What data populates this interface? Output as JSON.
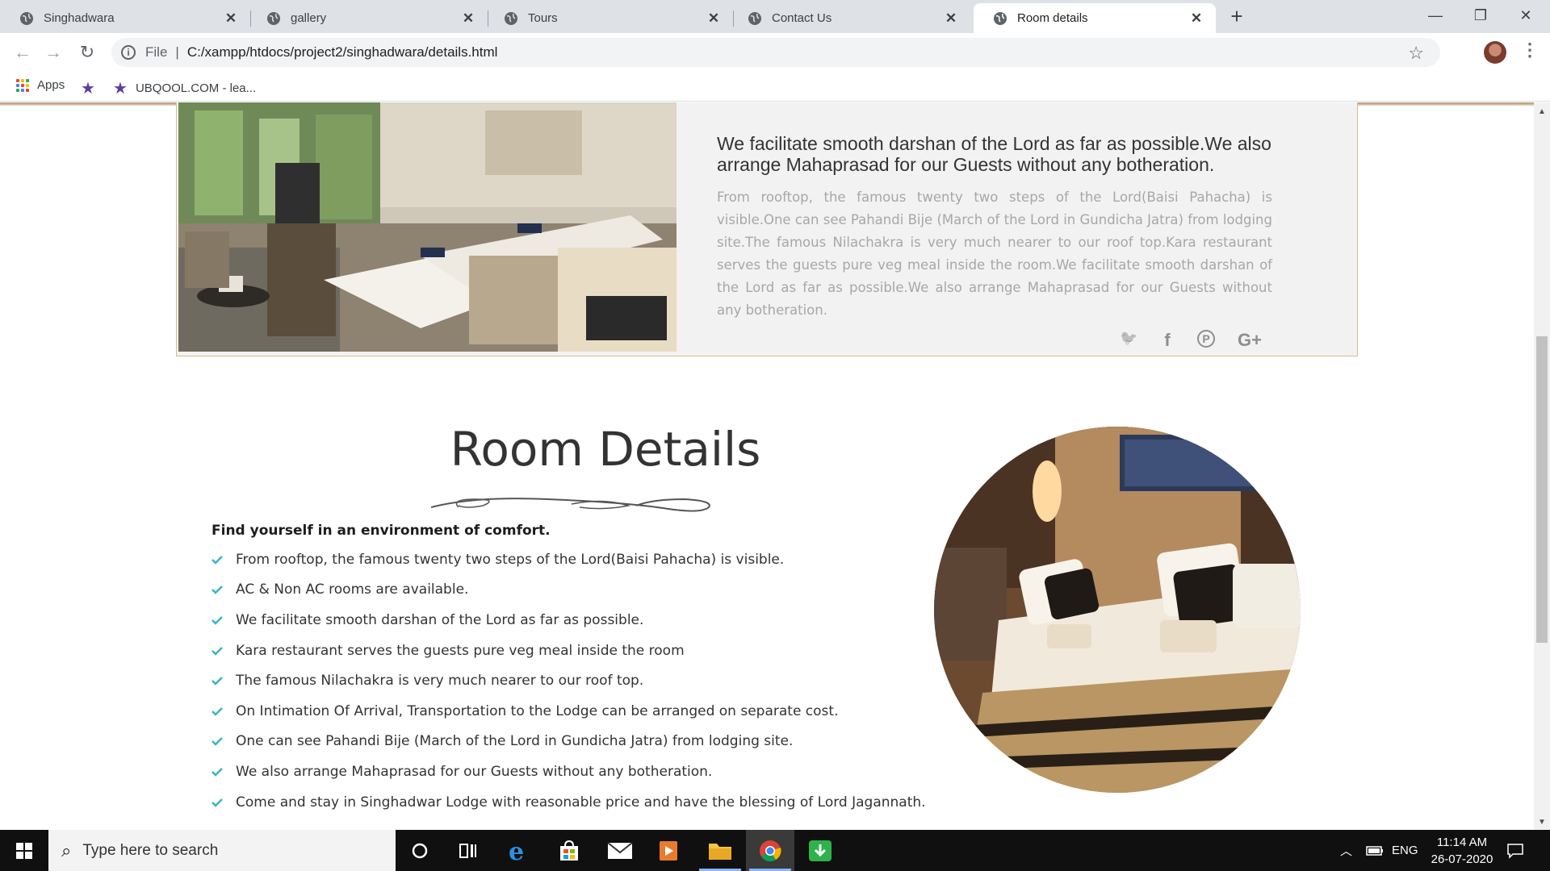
{
  "browser": {
    "tabs": [
      {
        "title": "Singhadwara",
        "active": false
      },
      {
        "title": "gallery",
        "active": false
      },
      {
        "title": "Tours",
        "active": false
      },
      {
        "title": "Contact Us",
        "active": false
      },
      {
        "title": "Room details",
        "active": true
      }
    ],
    "new_tab": "+",
    "minimize": "—",
    "restore": "❐",
    "close": "✕",
    "scheme_label": "File",
    "url": "C:/xampp/htdocs/project2/singhadwara/details.html",
    "bookmarks": [
      {
        "label": "Apps",
        "icon": "apps-grid-icon"
      },
      {
        "label": "",
        "icon": "star-bookmark-icon"
      },
      {
        "label": "UBQOOL.COM - lea...",
        "icon": "ubqool-icon"
      }
    ]
  },
  "card": {
    "heading": "We facilitate smooth darshan of the Lord as far as possible.We also arrange Mahaprasad for our Guests without any botheration.",
    "body": "From rooftop, the famous twenty two steps of the Lord(Baisi Pahacha) is visible.One can see Pahandi Bije (March of the Lord in Gundicha Jatra) from lodging site.The famous Nilachakra is very much nearer to our roof top.Kara restaurant serves the guests pure veg meal inside the room.We facilitate smooth darshan of the Lord as far as possible.We also arrange Mahaprasad for our Guests without any botheration.",
    "socials": [
      "twitter-icon",
      "facebook-icon",
      "pinterest-icon",
      "google-plus-icon"
    ],
    "social_glyphs": {
      "twitter": "🐦",
      "facebook": "f",
      "pinterest": "P",
      "google_plus": "G+"
    }
  },
  "room_details": {
    "title": "Room Details",
    "subtitle": "Find yourself in an environment of comfort.",
    "features": [
      "From rooftop, the famous twenty two steps of the Lord(Baisi Pahacha) is visible.",
      "AC & Non AC rooms are available.",
      "We facilitate smooth darshan of the Lord as far as possible.",
      "Kara restaurant serves the guests pure veg meal inside the room",
      "The famous Nilachakra is very much nearer to our roof top.",
      "On Intimation Of Arrival, Transportation to the Lodge can be arranged on separate cost.",
      "One can see Pahandi Bije (March of the Lord in Gundicha Jatra) from lodging site.",
      "We also arrange Mahaprasad for our Guests without any botheration.",
      "Come and stay in Singhadwar Lodge with reasonable price and have the blessing of Lord Jagannath."
    ]
  },
  "taskbar": {
    "search_placeholder": "Type here to search",
    "language": "ENG",
    "time": "11:14 AM",
    "date": "26-07-2020"
  },
  "colors": {
    "accent_check": "#3bb4c1",
    "card_border": "#e0b98f",
    "tab_strip": "#dee1e6",
    "taskbar": "#101010"
  }
}
